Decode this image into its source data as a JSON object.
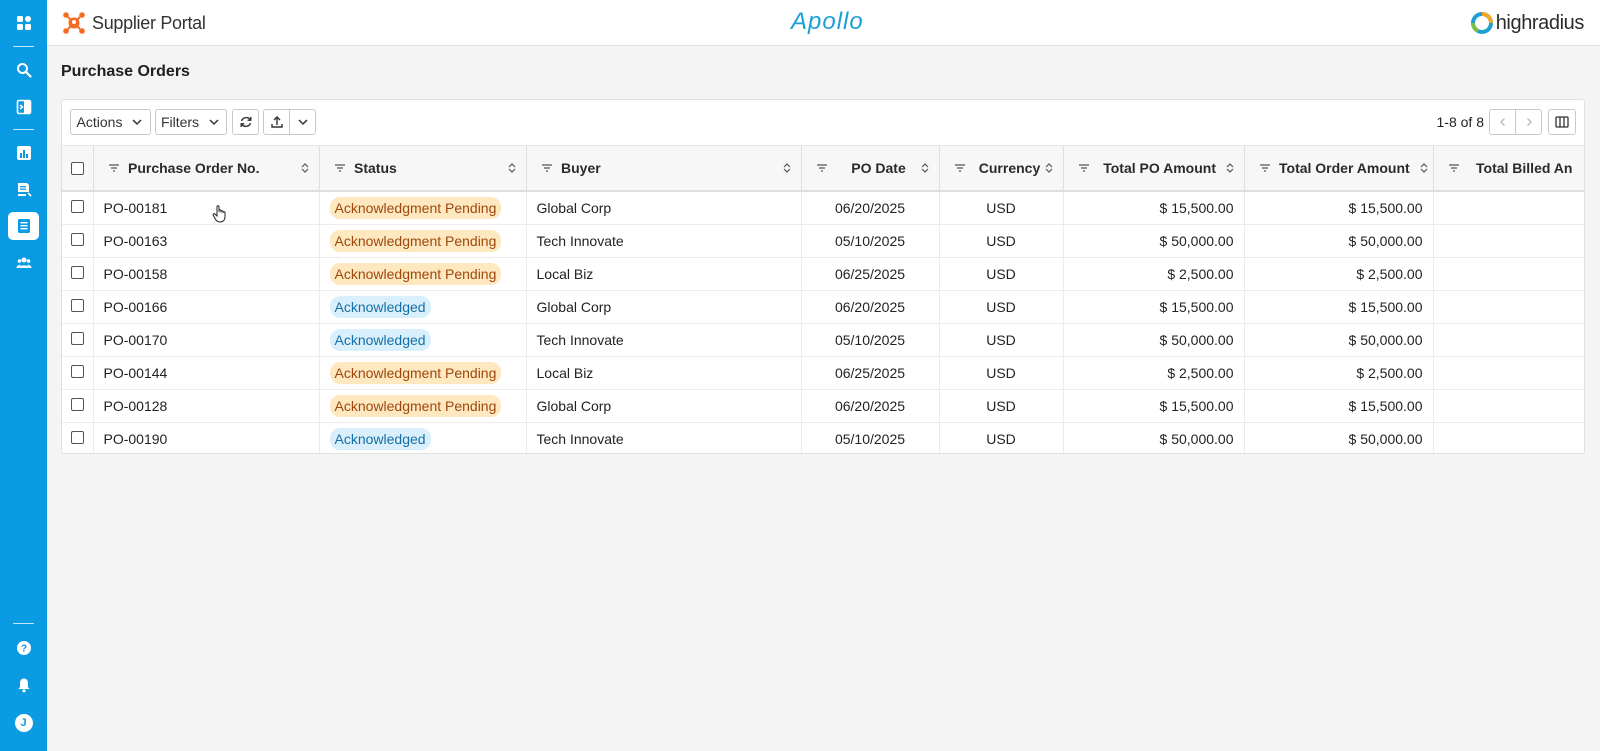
{
  "header": {
    "brand_name": "Supplier Portal",
    "product_name": "Apollo",
    "company_logo_text": "highradius"
  },
  "sidebar": {
    "items": [
      {
        "icon": "apps-icon",
        "active": false
      },
      {
        "icon": "search-icon",
        "active": false
      },
      {
        "icon": "invoice-icon",
        "active": false
      },
      {
        "icon": "analytics-icon",
        "active": false
      },
      {
        "icon": "documents-icon",
        "active": false
      },
      {
        "icon": "purchase-orders-icon",
        "active": true
      },
      {
        "icon": "users-icon",
        "active": false
      }
    ],
    "bottom": {
      "help_icon": "help-icon",
      "notifications_icon": "bell-icon",
      "avatar_initial": "J"
    }
  },
  "page": {
    "title": "Purchase Orders"
  },
  "toolbar": {
    "actions_label": "Actions",
    "filters_label": "Filters",
    "refresh_icon": "refresh-icon",
    "export_icon": "export-icon",
    "more_icon": "chevron-down-icon",
    "pagination_text": "1-8 of 8",
    "columns_icon": "columns-icon"
  },
  "table": {
    "columns": [
      "Purchase Order No.",
      "Status",
      "Buyer",
      "PO Date",
      "Currency",
      "Total PO Amount",
      "Total Order Amount",
      "Total Billed An"
    ],
    "rows": [
      {
        "po": "PO-00181",
        "status": "Acknowledgment Pending",
        "status_type": "pending",
        "buyer": "Global Corp",
        "date": "06/20/2025",
        "currency": "USD",
        "po_amount": "$ 15,500.00",
        "order_amount": "$ 15,500.00",
        "billed": ""
      },
      {
        "po": "PO-00163",
        "status": "Acknowledgment Pending",
        "status_type": "pending",
        "buyer": "Tech Innovate",
        "date": "05/10/2025",
        "currency": "USD",
        "po_amount": "$ 50,000.00",
        "order_amount": "$ 50,000.00",
        "billed": ""
      },
      {
        "po": "PO-00158",
        "status": "Acknowledgment Pending",
        "status_type": "pending",
        "buyer": "Local Biz",
        "date": "06/25/2025",
        "currency": "USD",
        "po_amount": "$ 2,500.00",
        "order_amount": "$ 2,500.00",
        "billed": ""
      },
      {
        "po": "PO-00166",
        "status": "Acknowledged",
        "status_type": "ack",
        "buyer": "Global Corp",
        "date": "06/20/2025",
        "currency": "USD",
        "po_amount": "$ 15,500.00",
        "order_amount": "$ 15,500.00",
        "billed": ""
      },
      {
        "po": "PO-00170",
        "status": "Acknowledged",
        "status_type": "ack",
        "buyer": "Tech Innovate",
        "date": "05/10/2025",
        "currency": "USD",
        "po_amount": "$ 50,000.00",
        "order_amount": "$ 50,000.00",
        "billed": ""
      },
      {
        "po": "PO-00144",
        "status": "Acknowledgment Pending",
        "status_type": "pending",
        "buyer": "Local Biz",
        "date": "06/25/2025",
        "currency": "USD",
        "po_amount": "$ 2,500.00",
        "order_amount": "$ 2,500.00",
        "billed": ""
      },
      {
        "po": "PO-00128",
        "status": "Acknowledgment Pending",
        "status_type": "pending",
        "buyer": "Global Corp",
        "date": "06/20/2025",
        "currency": "USD",
        "po_amount": "$ 15,500.00",
        "order_amount": "$ 15,500.00",
        "billed": ""
      },
      {
        "po": "PO-00190",
        "status": "Acknowledged",
        "status_type": "ack",
        "buyer": "Tech Innovate",
        "date": "05/10/2025",
        "currency": "USD",
        "po_amount": "$ 50,000.00",
        "order_amount": "$ 50,000.00",
        "billed": ""
      }
    ]
  },
  "colors": {
    "sidebar": "#0b9be3",
    "pending_bg": "#fde8bf",
    "pending_text": "#a0470d",
    "ack_bg": "#d9effb",
    "ack_text": "#1470a6",
    "brand_orange": "#f26b21",
    "apollo_blue": "#1a9fd6"
  }
}
